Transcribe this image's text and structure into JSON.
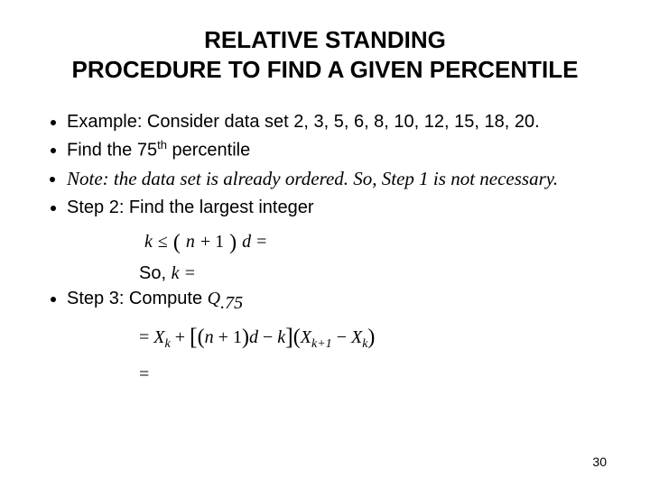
{
  "title_line1": "RELATIVE STANDING",
  "title_line2": "PROCEDURE TO FIND A GIVEN PERCENTILE",
  "bullets": {
    "b1": "Example: Consider data set 2, 3, 5, 6, 8, 10, 12, 15, 18, 20.",
    "b2_pre": "Find the 75",
    "b2_sup": "th",
    "b2_post": " percentile",
    "b3": "Note: the data set is already ordered. So, Step 1 is not necessary.",
    "b4": "Step 2: Find the largest integer"
  },
  "formula1": {
    "k": "k",
    "le": "≤",
    "lpar": "(",
    "n": "n",
    "plus1": " + 1",
    "rpar": ")",
    "d": "d",
    "eqend": " ="
  },
  "so_label": "So,  ",
  "so_math": "k =",
  "step3_label": "Step 3: Compute  ",
  "step3_q": "Q",
  "step3_qsub": ".75",
  "formula2": {
    "eq": "= ",
    "Xk": "X",
    "k_sub": "k",
    "plus": " + ",
    "lbr": "[",
    "lpar": "(",
    "n": "n",
    "plus1": " + 1",
    "rpar": ")",
    "d": "d",
    "minus": " − ",
    "k": "k",
    "rbr": "]",
    "mul_l": "(",
    "Xk1": "X",
    "k1_sub": "k+1",
    "minus2": " − ",
    "Xk2": "X",
    "k2_sub": "k",
    "mul_r": ")"
  },
  "eq_only": "=",
  "page_number": "30"
}
